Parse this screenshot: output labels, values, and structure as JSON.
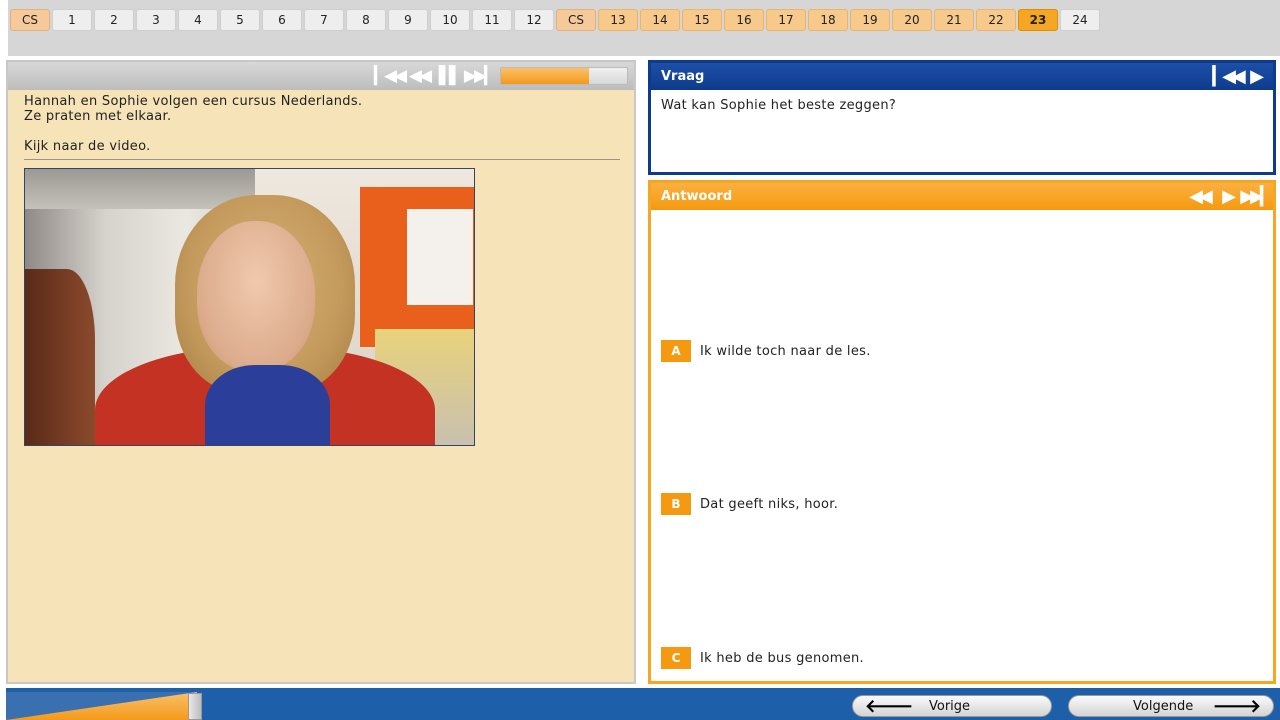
{
  "tabs": [
    {
      "label": "CS",
      "state": "cs"
    },
    {
      "label": "1",
      "state": "plain"
    },
    {
      "label": "2",
      "state": "plain"
    },
    {
      "label": "3",
      "state": "plain"
    },
    {
      "label": "4",
      "state": "plain"
    },
    {
      "label": "5",
      "state": "plain"
    },
    {
      "label": "6",
      "state": "plain"
    },
    {
      "label": "7",
      "state": "plain"
    },
    {
      "label": "8",
      "state": "plain"
    },
    {
      "label": "9",
      "state": "plain"
    },
    {
      "label": "10",
      "state": "plain"
    },
    {
      "label": "11",
      "state": "plain"
    },
    {
      "label": "12",
      "state": "plain"
    },
    {
      "label": "CS",
      "state": "cs"
    },
    {
      "label": "13",
      "state": "done"
    },
    {
      "label": "14",
      "state": "done"
    },
    {
      "label": "15",
      "state": "done"
    },
    {
      "label": "16",
      "state": "done"
    },
    {
      "label": "17",
      "state": "done"
    },
    {
      "label": "18",
      "state": "done"
    },
    {
      "label": "19",
      "state": "done"
    },
    {
      "label": "20",
      "state": "done"
    },
    {
      "label": "21",
      "state": "done"
    },
    {
      "label": "22",
      "state": "done"
    },
    {
      "label": "23",
      "state": "current"
    },
    {
      "label": "24",
      "state": "plain"
    }
  ],
  "media_controls": {
    "restart_icon": "skip-to-start-icon",
    "rewind_icon": "rewind-icon",
    "pause_icon": "pause-icon",
    "forward_icon": "skip-forward-icon",
    "progress_percent": 70
  },
  "intro": {
    "line1": "Hannah en Sophie volgen een cursus Nederlands.",
    "line2": "Ze praten met elkaar.",
    "instruction": "Kijk naar de video."
  },
  "video": {
    "description_icon": "video-frame"
  },
  "vraag": {
    "title": "Vraag",
    "question": "Wat kan Sophie het beste zeggen?"
  },
  "antwoord": {
    "title": "Antwoord",
    "options": [
      {
        "letter": "A",
        "text": "Ik wilde toch naar de les."
      },
      {
        "letter": "B",
        "text": "Dat geeft niks, hoor."
      },
      {
        "letter": "C",
        "text": "Ik heb de bus genomen."
      }
    ]
  },
  "bottom": {
    "progress_percent": 15,
    "prev_label": "Vorige",
    "next_label": "Volgende"
  },
  "colors": {
    "accent_orange": "#f5a623",
    "accent_blue": "#0e3b8c",
    "panel_cream": "#f7e3b8"
  }
}
